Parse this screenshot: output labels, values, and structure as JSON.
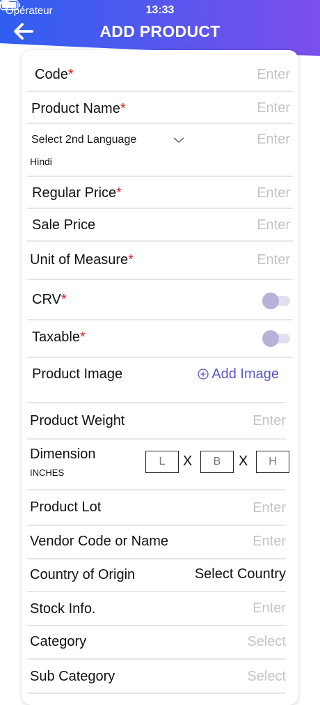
{
  "status_bar": {
    "carrier": "Opérateur",
    "time": "13:33"
  },
  "header": {
    "title": "ADD PRODUCT"
  },
  "colors": {
    "header_start": "#2f5ff0",
    "header_end": "#7b4fec",
    "accent": "#5a58c8",
    "required": "#d32020"
  },
  "form": {
    "code": {
      "label": "Code",
      "required": "*",
      "placeholder": "Enter"
    },
    "product_name": {
      "label": "Product Name",
      "required": "*",
      "placeholder": "Enter"
    },
    "second_language": {
      "label": "Select 2nd Language",
      "value": "Hindi",
      "placeholder": "Enter"
    },
    "regular_price": {
      "label": "Regular Price",
      "required": "*",
      "placeholder": "Enter"
    },
    "sale_price": {
      "label": "Sale Price",
      "placeholder": "Enter"
    },
    "unit_of_measure": {
      "label": "Unit of Measure",
      "required": "*",
      "placeholder": "Enter"
    },
    "crv": {
      "label": "CRV",
      "required": "*",
      "toggle": false
    },
    "taxable": {
      "label": "Taxable",
      "required": "*",
      "toggle": false
    },
    "product_image": {
      "label": "Product Image",
      "action": "Add Image"
    },
    "product_weight": {
      "label": "Product Weight",
      "placeholder": "Enter"
    },
    "dimension": {
      "label": "Dimension",
      "unit": "INCHES",
      "l": "L",
      "b": "B",
      "h": "H",
      "sep": "X"
    },
    "product_lot": {
      "label": "Product Lot",
      "placeholder": "Enter"
    },
    "vendor": {
      "label": "Vendor Code or Name",
      "placeholder": "Enter"
    },
    "country": {
      "label": "Country of Origin",
      "value": "Select Country"
    },
    "stock_info": {
      "label": "Stock Info.",
      "placeholder": "Enter"
    },
    "category": {
      "label": "Category",
      "placeholder": "Select"
    },
    "sub_category": {
      "label": "Sub Category",
      "placeholder": "Select"
    }
  }
}
